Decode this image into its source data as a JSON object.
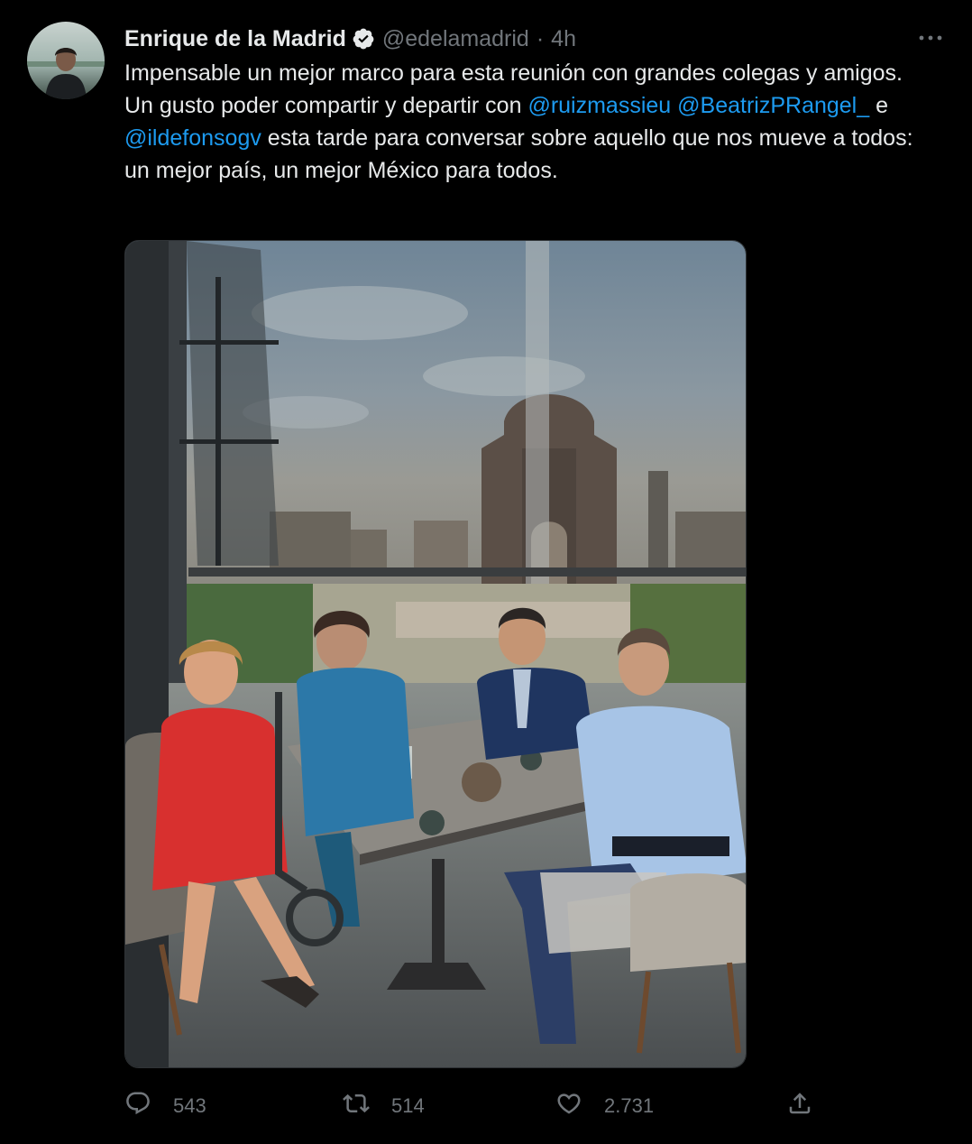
{
  "author": {
    "name": "Enrique de la Madrid",
    "handle": "@edelamadrid",
    "separator": "·",
    "time": "4h",
    "verified": true
  },
  "tweet": {
    "line1": "Impensable un mejor marco para esta reunión con grandes colegas y amigos.",
    "line2_prefix": "Un gusto poder compartir y departir con ",
    "mention1": "@ruizmassieu",
    "space": " ",
    "mention2": "@BeatrizPRangel_",
    "conj": " e ",
    "mention3": "@ildefonsogv",
    "line2_suffix": " esta tarde para conversar sobre aquello que nos mueve a todos: un mejor país, un mejor México para todos."
  },
  "media": {
    "description_icon": "photo"
  },
  "actions": {
    "replies": "543",
    "retweets": "514",
    "likes": "2.731"
  },
  "icons": {
    "reply": "reply-icon",
    "retweet": "retweet-icon",
    "like": "heart-icon",
    "share": "share-icon",
    "more": "more-icon",
    "verified": "verified-badge-icon"
  },
  "colors": {
    "background": "#000000",
    "text": "#e7e9ea",
    "secondary": "#71767b",
    "link": "#1d9bf0"
  }
}
